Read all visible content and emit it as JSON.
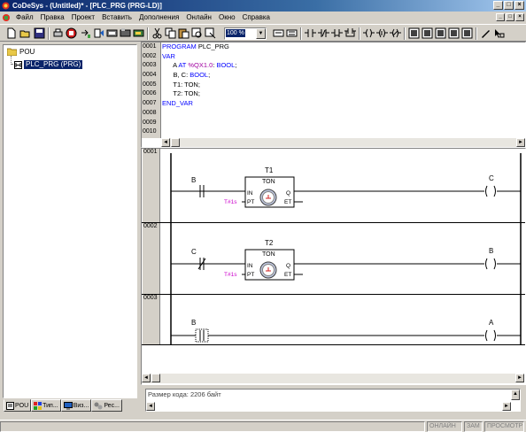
{
  "window": {
    "title": "CoDeSys - (Untitled)* - [PLC_PRG (PRG-LD)]",
    "controls": {
      "minimize": "_",
      "maximize": "□",
      "close": "×"
    }
  },
  "menu": [
    "Файл",
    "Правка",
    "Проект",
    "Вставить",
    "Дополнения",
    "Онлайн",
    "Окно",
    "Справка"
  ],
  "toolbar": {
    "zoom": "100 %",
    "buttons": [
      "new-icon",
      "open-icon",
      "save-icon",
      "print-icon",
      "run-icon",
      "stop-icon",
      "step-icon",
      "build-icon",
      "download-icon",
      "login-icon",
      "logout-icon",
      "cut-icon",
      "copy-icon",
      "paste-icon",
      "find-icon",
      "contact-icon",
      "parallel-contact-icon",
      "coil-icon",
      "box-icon",
      "comment-icon",
      "network-icon",
      "jump-icon",
      "return-icon",
      "set-icon",
      "reset-icon",
      "negate-icon",
      "edge-icon",
      "draw-icon",
      "select-icon"
    ]
  },
  "project_tree": {
    "root": "POU",
    "items": [
      {
        "label": "PLC_PRG (PRG)",
        "selected": true
      }
    ]
  },
  "left_tabs": [
    {
      "label": "POU",
      "icon": "pou-icon",
      "active": true
    },
    {
      "label": "Тип...",
      "icon": "types-icon",
      "active": false
    },
    {
      "label": "Виз...",
      "icon": "visualization-icon",
      "active": false
    },
    {
      "label": "Рес...",
      "icon": "resources-icon",
      "active": false
    }
  ],
  "declaration": {
    "line_numbers": [
      "0001",
      "0002",
      "0003",
      "0004",
      "0005",
      "0006",
      "0007",
      "0008",
      "0009",
      "0010"
    ],
    "lines": [
      {
        "kw": "PROGRAM",
        "rest": " PLC_PRG",
        "addr": "",
        "tail": ""
      },
      {
        "kw": "VAR",
        "rest": "",
        "addr": "",
        "tail": ""
      },
      {
        "kw": "",
        "rest": "      A ",
        "kw2": "AT",
        "addr": " %QX1.0",
        "tail": ": ",
        "type": "BOOL",
        "end": ";"
      },
      {
        "kw": "",
        "rest": "      B, C: ",
        "type": "BOOL",
        "end": ";"
      },
      {
        "kw": "",
        "rest": "      T1: TON;"
      },
      {
        "kw": "",
        "rest": "      T2: TON;"
      },
      {
        "kw": "END_VAR",
        "rest": ""
      },
      {
        "kw": "",
        "rest": ""
      },
      {
        "kw": "",
        "rest": ""
      },
      {
        "kw": "",
        "rest": ""
      }
    ]
  },
  "networks": [
    {
      "number": "0001",
      "contact": "B",
      "contact_type": "NO",
      "timer_instance": "T1",
      "timer_type": "TON",
      "preset": "T#1s",
      "coil": "C",
      "pins": [
        "IN",
        "PT",
        "Q",
        "ET"
      ]
    },
    {
      "number": "0002",
      "contact": "C",
      "contact_type": "NC",
      "timer_instance": "T2",
      "timer_type": "TON",
      "preset": "T#1s",
      "coil": "B",
      "pins": [
        "IN",
        "PT",
        "Q",
        "ET"
      ]
    },
    {
      "number": "0003",
      "contact": "B",
      "contact_type": "NO-selected",
      "coil": "A"
    }
  ],
  "messages": {
    "text": "Размер кода: 2206 байт"
  },
  "statusbar": [
    "ОНЛАЙН",
    "ЗАМ",
    "ПРОСМОТР"
  ],
  "colors": {
    "titlebar": "#0a246a",
    "keyword": "#0000ff",
    "address": "#a000a0",
    "preset": "#cc00cc",
    "selection": "#0a246a"
  }
}
